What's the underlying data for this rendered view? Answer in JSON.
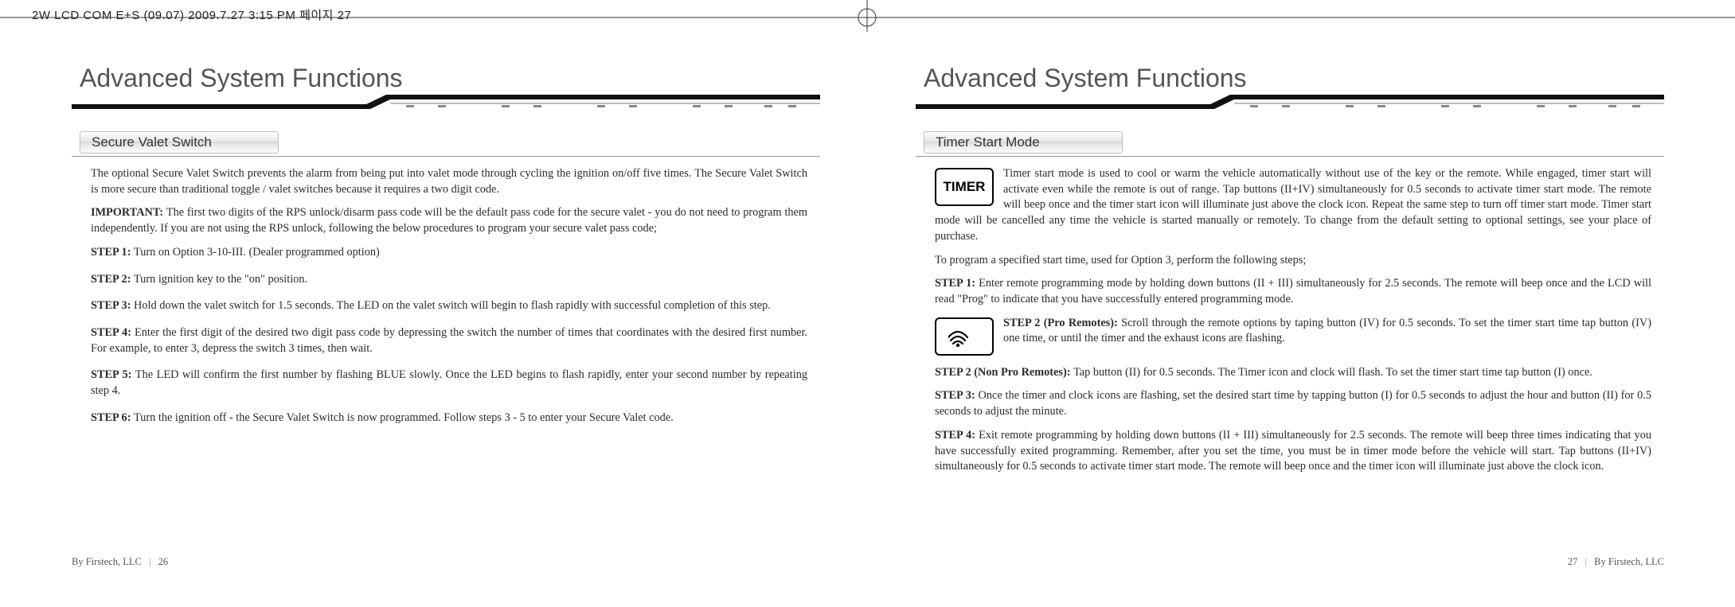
{
  "top_header": "2W LCD COM E+S (09.07)  2009.7.27 3:15 PM  페이지 27",
  "page_left": {
    "title": "Advanced System Functions",
    "section_header": "Secure Valet Switch",
    "p1": "The optional Secure Valet Switch prevents the alarm from being put into valet mode through cycling the ignition on/off five times. The Secure Valet Switch is more secure than traditional toggle / valet switches because it requires a two digit code.",
    "p2_label": "IMPORTANT: ",
    "p2": "The first two digits of the RPS unlock/disarm pass code will be the default pass code for the secure valet - you do not need to program them independently. If you are not using the RPS unlock, following the below procedures to program your secure valet pass code;",
    "s1_label": "STEP 1: ",
    "s1": "Turn on Option 3-10-III. (Dealer programmed option)",
    "s2_label": "STEP 2: ",
    "s2": "Turn ignition key to the \"on\" position.",
    "s3_label": "STEP 3: ",
    "s3": "Hold down the valet switch for 1.5 seconds. The LED on the valet switch will begin to flash rapidly with successful completion of this step.",
    "s4_label": "STEP 4: ",
    "s4": "Enter the first digit of the desired two digit pass code by depressing the switch the number of times that coordinates with the desired first number. For example, to enter 3, depress the switch 3 times, then wait.",
    "s5_label": "STEP 5: ",
    "s5": "The LED will confirm the first number by flashing BLUE slowly. Once the LED begins to flash rapidly, enter your second number by repeating step 4.",
    "s6_label": "STEP 6: ",
    "s6": "Turn the ignition off - the Secure Valet Switch is now programmed. Follow steps 3 - 5 to enter your Secure Valet code.",
    "footer_company": "By Firstech, LLC",
    "footer_page": "26"
  },
  "page_right": {
    "title": "Advanced System Functions",
    "section_header": "Timer Start Mode",
    "icon_label": "TIMER",
    "p1": "Timer start mode is used to cool or warm the vehicle automatically without use of the key or the remote. While engaged, timer start will activate even while the remote is out of range. Tap buttons (II+IV) simultaneously for 0.5 seconds to activate timer start mode. The remote will beep once and the timer start icon will illuminate just above the clock icon. Repeat the same step to turn off timer start mode. Timer start mode will be cancelled any time the vehicle is started manually or remotely. To change from the default setting to optional settings, see your place of purchase.",
    "p2": "To program a specified start time, used for Option 3, perform the following steps;",
    "s1_label": "STEP 1: ",
    "s1": "Enter remote programming mode by holding down buttons (II + III) simultaneously for 2.5 seconds. The remote will beep once and the LCD will read \"Prog\" to indicate that you have successfully entered programming mode.",
    "s2a_label": "STEP 2 (Pro Remotes): ",
    "s2a": "Scroll through the remote options by taping button (IV) for 0.5 seconds.  To set the timer start time tap button (IV) one time, or until the timer and the exhaust icons are flashing.",
    "s2b_label": "STEP 2 (Non Pro Remotes): ",
    "s2b": "Tap button (II) for 0.5 seconds. The Timer icon and clock will flash. To set the timer start time tap button (I) once.",
    "s3_label": "STEP 3: ",
    "s3": "Once the timer and clock icons are flashing, set the desired start time by tapping button (I) for 0.5 seconds to adjust the hour and button (II) for 0.5 seconds to adjust the minute.",
    "s4_label": "STEP 4: ",
    "s4": "Exit remote programming by holding down buttons (II + III) simultaneously for 2.5 seconds. The remote will beep three times indicating that you have successfully exited programming.  Remember, after you set the time, you must be in timer mode before the vehicle will start. Tap buttons (II+IV) simultaneously for 0.5 seconds to activate timer start mode. The remote will beep once and the timer icon will illuminate just above the clock icon.",
    "footer_company": "By Firstech, LLC",
    "footer_page": "27"
  }
}
